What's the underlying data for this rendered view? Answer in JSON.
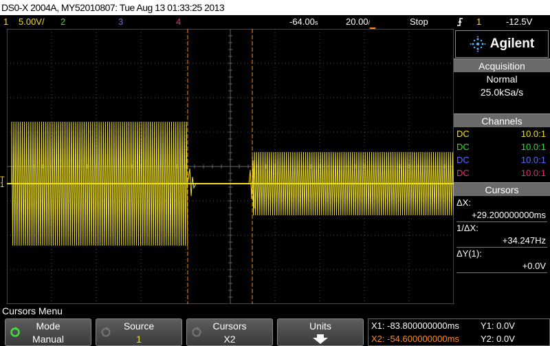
{
  "title": "DS0-X 2004A, MY52010807: Tue Aug 13 01:33:25 2013",
  "channel_bar": {
    "ch1_num": "1",
    "ch1_scale": "5.00V/",
    "ch2_num": "2",
    "ch3_num": "3",
    "ch4_num": "4",
    "time_delay": "-64.00",
    "time_delay_unit": "s",
    "time_scale": "20.00",
    "time_scale_unit": "/",
    "run_state": "Stop",
    "trigger_source": "1",
    "trigger_level": "-12.5V"
  },
  "side_panel": {
    "logo": "Agilent",
    "acquisition": {
      "header": "Acquisition",
      "mode": "Normal",
      "rate": "25.0kSa/s"
    },
    "channels": {
      "header": "Channels",
      "rows": [
        {
          "coupling": "DC",
          "probe": "10.0:1",
          "color": "#f0e020"
        },
        {
          "coupling": "DC",
          "probe": "10.0:1",
          "color": "#30e030"
        },
        {
          "coupling": "DC",
          "probe": "10.0:1",
          "color": "#5a6cff"
        },
        {
          "coupling": "DC",
          "probe": "10.0:1",
          "color": "#e0307a"
        }
      ]
    },
    "cursors": {
      "header": "Cursors",
      "dx_label": "ΔX:",
      "dx_value": "+29.200000000ms",
      "inv_dx_label": "1/ΔX:",
      "inv_dx_value": "+34.247Hz",
      "dy_label": "ΔY(1):",
      "dy_value": "+0.0V"
    }
  },
  "menu": {
    "title": "Cursors Menu",
    "keys": [
      {
        "label": "Mode",
        "value": "Manual"
      },
      {
        "label": "Source",
        "value": "1"
      },
      {
        "label": "Cursors",
        "value": "X2"
      },
      {
        "label": "Units",
        "value": ""
      }
    ],
    "readout": {
      "x1": "X1: -83.800000000ms",
      "x2": "X2: -54.600000000ms",
      "y1": "Y1: 0.0V",
      "y2": "Y2: 0.0V"
    }
  },
  "colors": {
    "ch1": "#f0e020",
    "ch2": "#30e030",
    "ch3": "#5a6cff",
    "ch4": "#e0307a",
    "cursor": "#ff8c1a",
    "panel_header": "#6a6a6a"
  },
  "icons": [
    "rotate-knob-icon",
    "down-arrow-icon",
    "trigger-edge-icon",
    "agilent-spark-icon",
    "trigger-delay-marker-icon"
  ]
}
